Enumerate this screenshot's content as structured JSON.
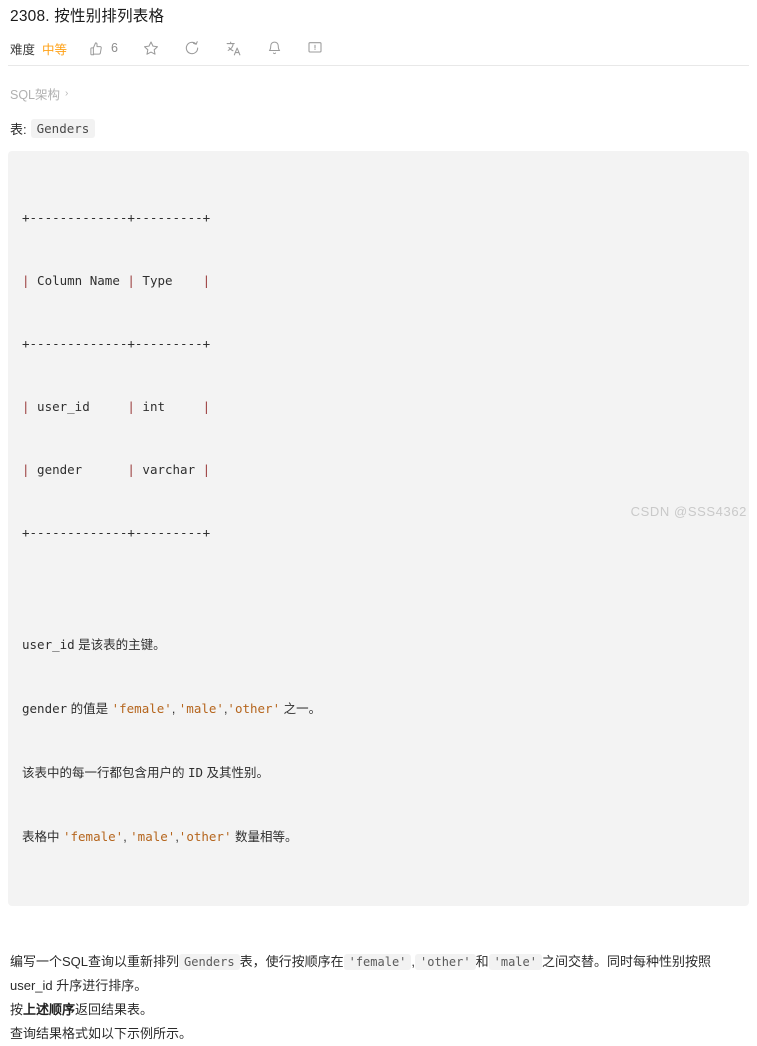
{
  "problem": {
    "title": "2308. 按性别排列表格",
    "difficulty_label": "难度",
    "difficulty_value": "中等",
    "difficulty_color": "#ffa116",
    "like_count": "6"
  },
  "toolbar": {
    "items": [
      {
        "name": "thumbs-up-icon",
        "label": "点赞"
      },
      {
        "name": "star-icon",
        "label": "收藏"
      },
      {
        "name": "share-icon",
        "label": "分享"
      },
      {
        "name": "translate-icon",
        "label": "切换语言"
      },
      {
        "name": "bell-icon",
        "label": "提醒"
      },
      {
        "name": "comment-icon",
        "label": "讨论"
      }
    ]
  },
  "schema": {
    "toggle_label": "SQL架构",
    "chevron": "›",
    "table_prefix": "表:",
    "table_name": "Genders"
  },
  "code_block": {
    "border_top": "+-------------+---------+",
    "header_row": {
      "pipe": "|",
      "col1": " Column Name ",
      "col2": " Type    "
    },
    "separator": "+-------------+---------+",
    "rows": [
      {
        "col1": " user_id     ",
        "col2": " int     "
      },
      {
        "col1": " gender      ",
        "col2": " varchar "
      }
    ],
    "border_bottom": "+-------------+---------+",
    "notes": [
      {
        "segments": [
          {
            "type": "code",
            "text": "user_id"
          },
          {
            "type": "cn",
            "text": " 是该表的主键。"
          }
        ]
      },
      {
        "segments": [
          {
            "type": "code",
            "text": "gender"
          },
          {
            "type": "cn",
            "text": " 的值是 "
          },
          {
            "type": "str",
            "text": "'female'"
          },
          {
            "type": "cn",
            "text": ", "
          },
          {
            "type": "str",
            "text": "'male'"
          },
          {
            "type": "cn",
            "text": ","
          },
          {
            "type": "str",
            "text": "'other'"
          },
          {
            "type": "cn",
            "text": " 之一。"
          }
        ]
      },
      {
        "segments": [
          {
            "type": "cn",
            "text": "该表中的每一行都包含用户的 "
          },
          {
            "type": "code",
            "text": "ID"
          },
          {
            "type": "cn",
            "text": " 及其性别。"
          }
        ]
      },
      {
        "segments": [
          {
            "type": "cn",
            "text": "表格中 "
          },
          {
            "type": "str",
            "text": "'female'"
          },
          {
            "type": "cn",
            "text": ", "
          },
          {
            "type": "str",
            "text": "'male'"
          },
          {
            "type": "cn",
            "text": ","
          },
          {
            "type": "str",
            "text": "'other'"
          },
          {
            "type": "cn",
            "text": " 数量相等。"
          }
        ]
      }
    ]
  },
  "description": {
    "line1_a": "编写一个SQL查询以重新排列",
    "line1_code1": "Genders",
    "line1_b": "表，使行按顺序在",
    "line1_code2": "'female'",
    "line1_c": ",",
    "line1_code3": "'other'",
    "line1_d": "和",
    "line1_code4": "'male'",
    "line1_e": "之间交替。同时每种性别按照 user_id 升序进行排序。",
    "line2_a": "按",
    "line2_bold": "上述顺序",
    "line2_b": "返回结果表。",
    "line3": "查询结果格式如以下示例所示。"
  },
  "watermark": {
    "text": "CSDN @SSS4362"
  }
}
